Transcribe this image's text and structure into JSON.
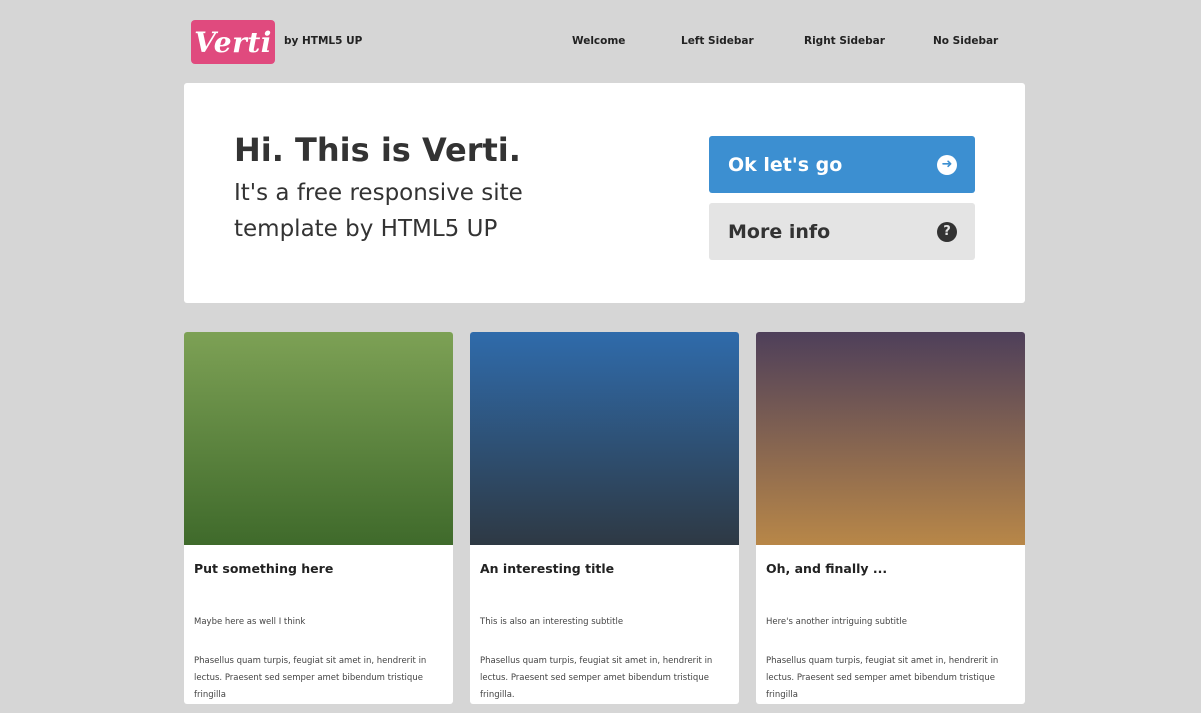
{
  "header": {
    "logo": "Verti",
    "byline": "by HTML5 UP",
    "nav": [
      "Welcome",
      "Left Sidebar",
      "Right Sidebar",
      "No Sidebar"
    ]
  },
  "banner": {
    "title": "Hi. This is Verti.",
    "subtitle": "It's a free responsive site template by HTML5 UP",
    "primary_button": "Ok let's go",
    "secondary_button": "More info"
  },
  "cards": [
    {
      "title": "Put something here",
      "subtitle": "Maybe here as well I think",
      "body": "Phasellus quam turpis, feugiat sit amet in, hendrerit in lectus. Praesent sed semper amet bibendum tristique fringilla",
      "image_colors": [
        "#7da155",
        "#3f6a2b"
      ]
    },
    {
      "title": "An interesting title",
      "subtitle": "This is also an interesting subtitle",
      "body": "Phasellus quam turpis, feugiat sit amet in, hendrerit in lectus. Praesent sed semper amet bibendum tristique fringilla.",
      "image_colors": [
        "#2f6bab",
        "#2e3944"
      ]
    },
    {
      "title": "Oh, and finally ...",
      "subtitle": "Here's another intriguing subtitle",
      "body": "Phasellus quam turpis, feugiat sit amet in, hendrerit in lectus. Praesent sed semper amet bibendum tristique fringilla",
      "image_colors": [
        "#4e3f5a",
        "#b88748"
      ]
    }
  ],
  "colors": {
    "accent_pink": "#e04a7e",
    "button_blue": "#3c8fd1",
    "page_bg": "#d6d6d6"
  },
  "icons": {
    "primary_button": "arrow-right-circle-icon",
    "secondary_button": "question-circle-icon"
  }
}
